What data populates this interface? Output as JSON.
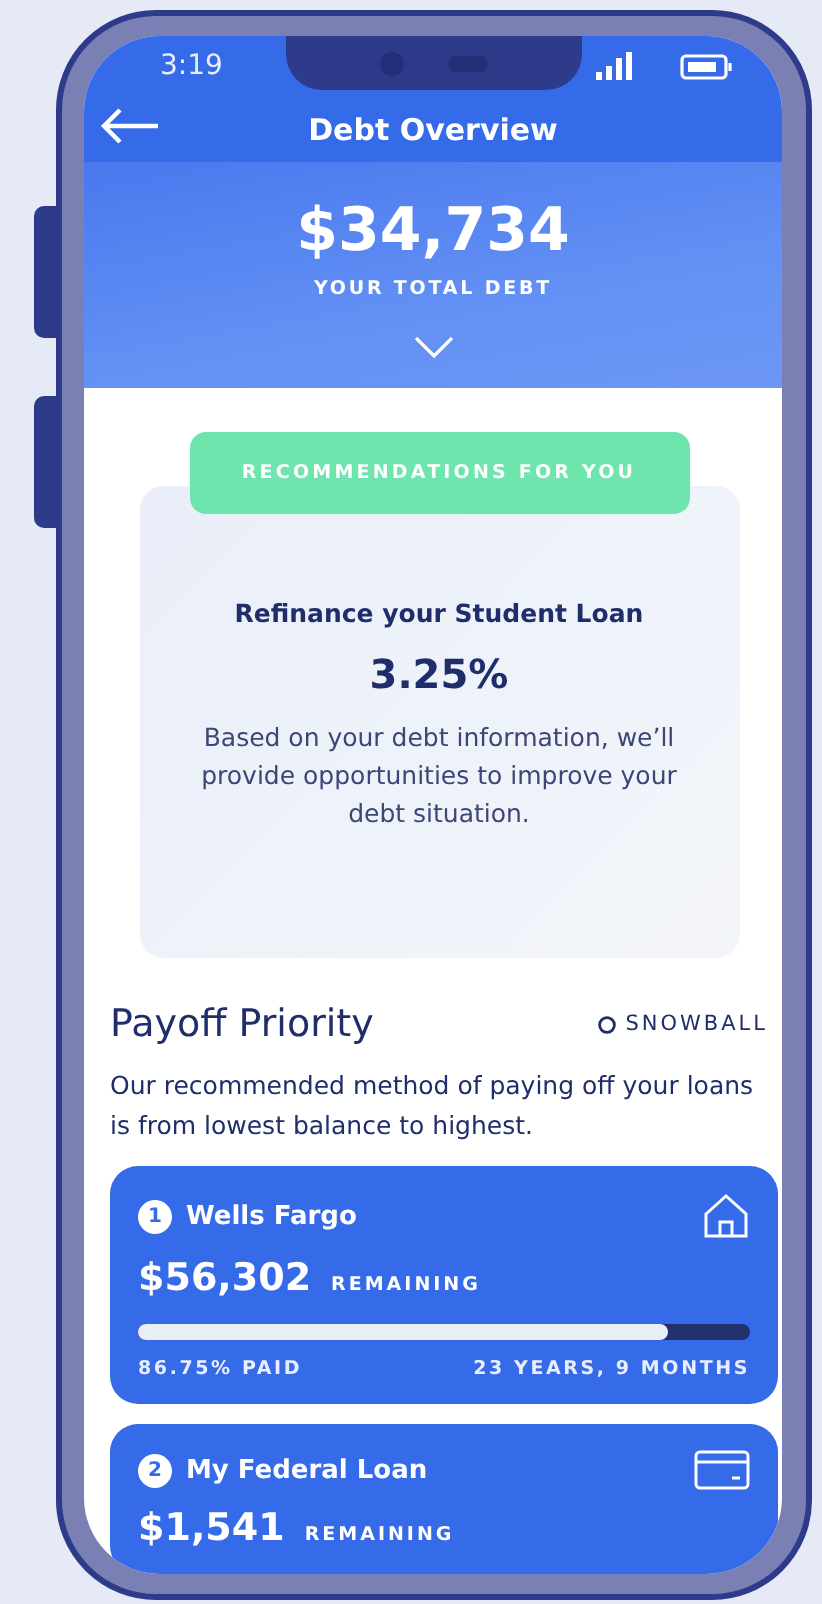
{
  "status_bar": {
    "time": "3:19"
  },
  "header": {
    "title": "Debt Overview"
  },
  "summary": {
    "amount": "$34,734",
    "label": "YOUR TOTAL DEBT"
  },
  "recommendation": {
    "badge": "RECOMMENDATIONS FOR YOU",
    "title": "Refinance your Student Loan",
    "rate": "3.25%",
    "text": "Based on your debt information, we’ll provide opportunities to improve your debt situation."
  },
  "payoff": {
    "title": "Payoff Priority",
    "method": "SNOWBALL",
    "description": "Our recommended method of paying off your loans is from lowest balance to highest."
  },
  "loans": [
    {
      "number": "1",
      "name": "Wells Fargo",
      "kind": "house",
      "amount": "$56,302",
      "amount_label": "REMAINING",
      "level": 0.8675,
      "paid": "86.75% PAID",
      "term": "23 YEARS, 9 MONTHS"
    },
    {
      "number": "2",
      "name": "My Federal Loan",
      "kind": "card",
      "amount": "$1,541",
      "amount_label": "REMAINING"
    }
  ]
}
